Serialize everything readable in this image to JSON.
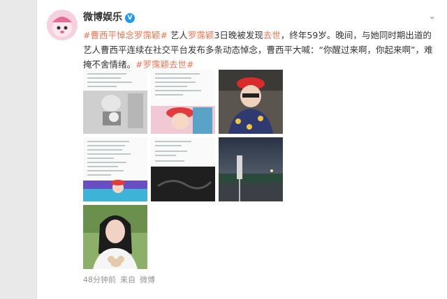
{
  "post": {
    "author": "微博娱乐",
    "verified_mark": "V",
    "more_icon": "chevron-down-icon",
    "body": {
      "hashtag1": "#曹西平悼念罗霈颖#",
      "seg1": " 艺人",
      "link_name": "罗霈颖",
      "seg2": "3日晚被发现",
      "link_dead": "去世",
      "seg3": "，终年59岁。晚间，与她同时期出道的艺人曹西平连续在社交平台发布多条动态悼念，曹西平大喊：“你醒过来啊，你起来啊”，难掩不舍情绪。",
      "hashtag2": "#罗霈颖去世#"
    },
    "meta": {
      "time": "48分钟前",
      "source_prefix": "来自",
      "source": "微博"
    }
  },
  "colors": {
    "accent_orange": "#eb7350",
    "accent_blue": "#4a8fd6"
  }
}
